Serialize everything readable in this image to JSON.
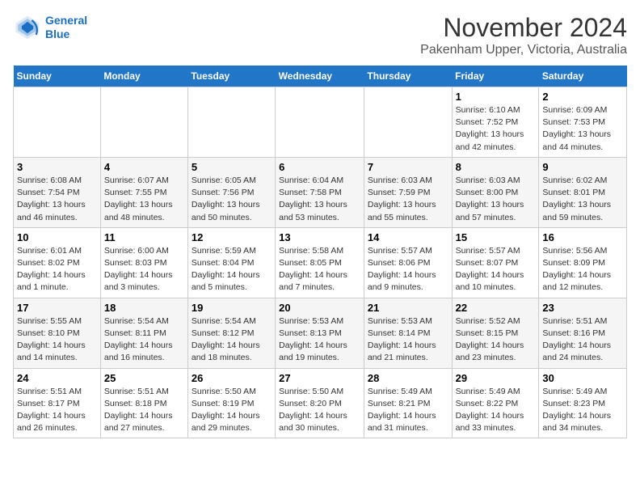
{
  "header": {
    "logo_line1": "General",
    "logo_line2": "Blue",
    "title": "November 2024",
    "subtitle": "Pakenham Upper, Victoria, Australia"
  },
  "weekdays": [
    "Sunday",
    "Monday",
    "Tuesday",
    "Wednesday",
    "Thursday",
    "Friday",
    "Saturday"
  ],
  "weeks": [
    [
      {
        "day": "",
        "info": ""
      },
      {
        "day": "",
        "info": ""
      },
      {
        "day": "",
        "info": ""
      },
      {
        "day": "",
        "info": ""
      },
      {
        "day": "",
        "info": ""
      },
      {
        "day": "1",
        "info": "Sunrise: 6:10 AM\nSunset: 7:52 PM\nDaylight: 13 hours\nand 42 minutes."
      },
      {
        "day": "2",
        "info": "Sunrise: 6:09 AM\nSunset: 7:53 PM\nDaylight: 13 hours\nand 44 minutes."
      }
    ],
    [
      {
        "day": "3",
        "info": "Sunrise: 6:08 AM\nSunset: 7:54 PM\nDaylight: 13 hours\nand 46 minutes."
      },
      {
        "day": "4",
        "info": "Sunrise: 6:07 AM\nSunset: 7:55 PM\nDaylight: 13 hours\nand 48 minutes."
      },
      {
        "day": "5",
        "info": "Sunrise: 6:05 AM\nSunset: 7:56 PM\nDaylight: 13 hours\nand 50 minutes."
      },
      {
        "day": "6",
        "info": "Sunrise: 6:04 AM\nSunset: 7:58 PM\nDaylight: 13 hours\nand 53 minutes."
      },
      {
        "day": "7",
        "info": "Sunrise: 6:03 AM\nSunset: 7:59 PM\nDaylight: 13 hours\nand 55 minutes."
      },
      {
        "day": "8",
        "info": "Sunrise: 6:03 AM\nSunset: 8:00 PM\nDaylight: 13 hours\nand 57 minutes."
      },
      {
        "day": "9",
        "info": "Sunrise: 6:02 AM\nSunset: 8:01 PM\nDaylight: 13 hours\nand 59 minutes."
      }
    ],
    [
      {
        "day": "10",
        "info": "Sunrise: 6:01 AM\nSunset: 8:02 PM\nDaylight: 14 hours\nand 1 minute."
      },
      {
        "day": "11",
        "info": "Sunrise: 6:00 AM\nSunset: 8:03 PM\nDaylight: 14 hours\nand 3 minutes."
      },
      {
        "day": "12",
        "info": "Sunrise: 5:59 AM\nSunset: 8:04 PM\nDaylight: 14 hours\nand 5 minutes."
      },
      {
        "day": "13",
        "info": "Sunrise: 5:58 AM\nSunset: 8:05 PM\nDaylight: 14 hours\nand 7 minutes."
      },
      {
        "day": "14",
        "info": "Sunrise: 5:57 AM\nSunset: 8:06 PM\nDaylight: 14 hours\nand 9 minutes."
      },
      {
        "day": "15",
        "info": "Sunrise: 5:57 AM\nSunset: 8:07 PM\nDaylight: 14 hours\nand 10 minutes."
      },
      {
        "day": "16",
        "info": "Sunrise: 5:56 AM\nSunset: 8:09 PM\nDaylight: 14 hours\nand 12 minutes."
      }
    ],
    [
      {
        "day": "17",
        "info": "Sunrise: 5:55 AM\nSunset: 8:10 PM\nDaylight: 14 hours\nand 14 minutes."
      },
      {
        "day": "18",
        "info": "Sunrise: 5:54 AM\nSunset: 8:11 PM\nDaylight: 14 hours\nand 16 minutes."
      },
      {
        "day": "19",
        "info": "Sunrise: 5:54 AM\nSunset: 8:12 PM\nDaylight: 14 hours\nand 18 minutes."
      },
      {
        "day": "20",
        "info": "Sunrise: 5:53 AM\nSunset: 8:13 PM\nDaylight: 14 hours\nand 19 minutes."
      },
      {
        "day": "21",
        "info": "Sunrise: 5:53 AM\nSunset: 8:14 PM\nDaylight: 14 hours\nand 21 minutes."
      },
      {
        "day": "22",
        "info": "Sunrise: 5:52 AM\nSunset: 8:15 PM\nDaylight: 14 hours\nand 23 minutes."
      },
      {
        "day": "23",
        "info": "Sunrise: 5:51 AM\nSunset: 8:16 PM\nDaylight: 14 hours\nand 24 minutes."
      }
    ],
    [
      {
        "day": "24",
        "info": "Sunrise: 5:51 AM\nSunset: 8:17 PM\nDaylight: 14 hours\nand 26 minutes."
      },
      {
        "day": "25",
        "info": "Sunrise: 5:51 AM\nSunset: 8:18 PM\nDaylight: 14 hours\nand 27 minutes."
      },
      {
        "day": "26",
        "info": "Sunrise: 5:50 AM\nSunset: 8:19 PM\nDaylight: 14 hours\nand 29 minutes."
      },
      {
        "day": "27",
        "info": "Sunrise: 5:50 AM\nSunset: 8:20 PM\nDaylight: 14 hours\nand 30 minutes."
      },
      {
        "day": "28",
        "info": "Sunrise: 5:49 AM\nSunset: 8:21 PM\nDaylight: 14 hours\nand 31 minutes."
      },
      {
        "day": "29",
        "info": "Sunrise: 5:49 AM\nSunset: 8:22 PM\nDaylight: 14 hours\nand 33 minutes."
      },
      {
        "day": "30",
        "info": "Sunrise: 5:49 AM\nSunset: 8:23 PM\nDaylight: 14 hours\nand 34 minutes."
      }
    ]
  ]
}
